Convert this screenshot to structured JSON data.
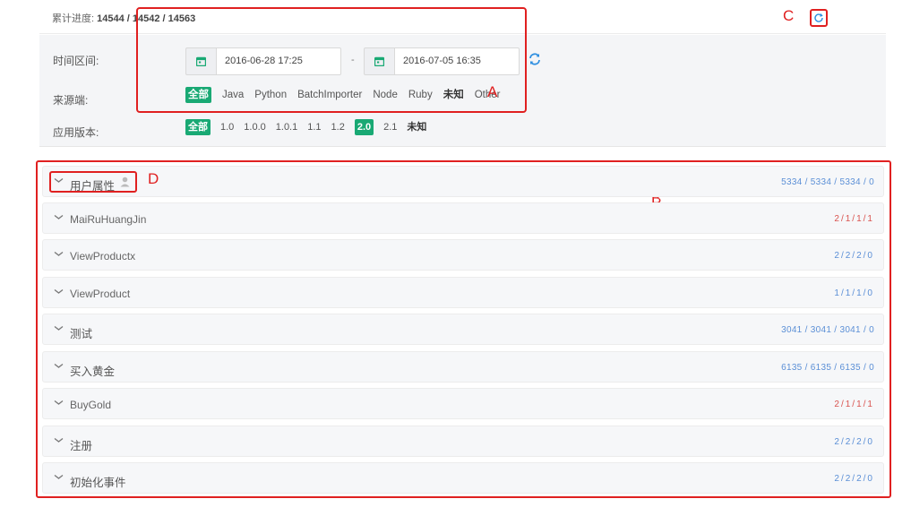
{
  "header": {
    "progress_label": "累计进度:",
    "progress_value": "14544 / 14542 / 14563",
    "refresh_icon": "refresh-icon"
  },
  "annotations": {
    "a": "A",
    "b": "B",
    "c": "C",
    "d": "D"
  },
  "filters": {
    "time_label": "时间区间:",
    "start_date": "2016-06-28 17:25",
    "end_date": "2016-07-05 16:35",
    "date_separator": "-",
    "source_label": "来源端:",
    "sources": [
      "全部",
      "Java",
      "Python",
      "BatchImporter",
      "Node",
      "Ruby",
      "未知",
      "Other"
    ],
    "source_selected": "全部",
    "version_label": "应用版本:",
    "versions": [
      "全部",
      "1.0",
      "1.0.0",
      "1.0.1",
      "1.1",
      "1.2",
      "2.0",
      "2.1",
      "未知"
    ],
    "versions_selected": [
      "全部",
      "2.0"
    ]
  },
  "events": [
    {
      "name": "用户属性",
      "count": "5334 / 5334 / 5334 / 0",
      "status": "normal"
    },
    {
      "name": "MaiRuHuangJin",
      "count": "2/1/1/1",
      "status": "error"
    },
    {
      "name": "ViewProductx",
      "count": "2/2/2/0",
      "status": "normal"
    },
    {
      "name": "ViewProduct",
      "count": "1/1/1/0",
      "status": "normal"
    },
    {
      "name": "测试",
      "count": "3041 / 3041 / 3041 / 0",
      "status": "normal"
    },
    {
      "name": "买入黄金",
      "count": "6135 / 6135 / 6135 / 0",
      "status": "normal"
    },
    {
      "name": "BuyGold",
      "count": "2/1/1/1",
      "status": "error"
    },
    {
      "name": "注册",
      "count": "2/2/2/0",
      "status": "normal"
    },
    {
      "name": "初始化事件",
      "count": "2/2/2/0",
      "status": "normal"
    }
  ],
  "colors": {
    "accent": "#19a974",
    "annotation": "#e02020",
    "count_normal": "#5b8fd6",
    "count_error": "#d9534f",
    "refresh": "#2f8fe0"
  }
}
